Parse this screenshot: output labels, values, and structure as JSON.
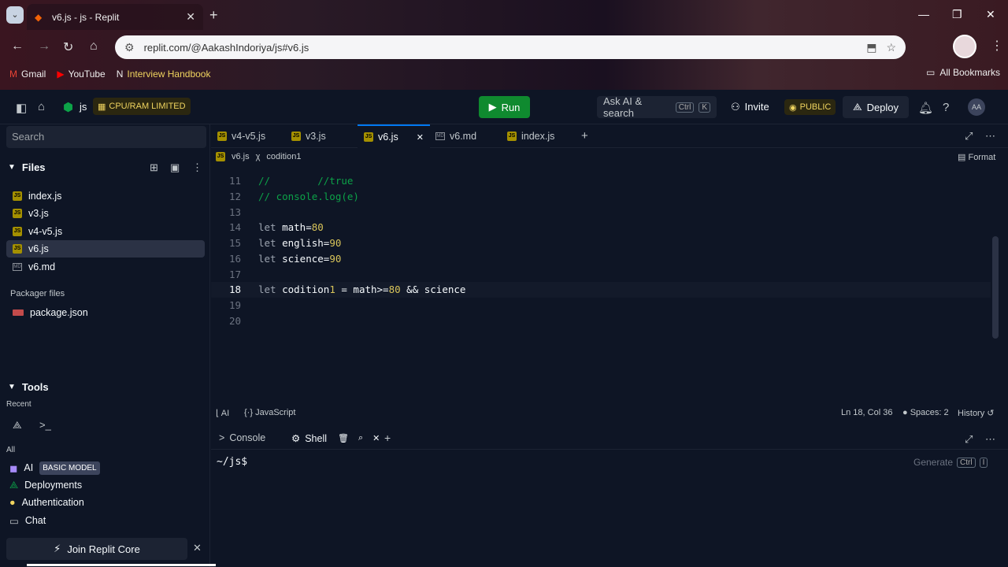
{
  "browser": {
    "tab_title": "v6.js - js - Replit",
    "url": "replit.com/@AakashIndoriya/js#v6.js",
    "bookmarks": [
      "Gmail",
      "YouTube",
      "Interview Handbook"
    ],
    "all_bookmarks": "All Bookmarks"
  },
  "topbar": {
    "repl_name": "js",
    "cpu_badge": "CPU/RAM LIMITED",
    "run_label": "Run",
    "ask_ai": "Ask AI & search",
    "kbd_ctrl": "Ctrl",
    "kbd_k": "K",
    "invite": "Invite",
    "public_badge": "PUBLIC",
    "deploy": "Deploy",
    "avatar": "AA"
  },
  "sidebar": {
    "search_placeholder": "Search",
    "files_header": "Files",
    "files": [
      {
        "name": "index.js",
        "type": "js"
      },
      {
        "name": "v3.js",
        "type": "js"
      },
      {
        "name": "v4-v5.js",
        "type": "js"
      },
      {
        "name": "v6.js",
        "type": "js",
        "selected": true
      },
      {
        "name": "v6.md",
        "type": "md"
      }
    ],
    "packager_header": "Packager files",
    "packager_files": [
      "package.json"
    ],
    "tools_header": "Tools",
    "recent_label": "Recent",
    "all_label": "All",
    "tools": [
      {
        "name": "AI",
        "badge": "BASIC MODEL"
      },
      {
        "name": "Deployments"
      },
      {
        "name": "Authentication"
      },
      {
        "name": "Chat"
      }
    ],
    "join": "Join Replit Core"
  },
  "editor": {
    "tabs": [
      "v4-v5.js",
      "v3.js",
      "v6.js",
      "v6.md",
      "index.js"
    ],
    "active_tab": "v6.js",
    "breadcrumb_file": "v6.js",
    "breadcrumb_symbol": "codition1",
    "format_label": "Format",
    "lines": [
      {
        "n": "11",
        "text": "//        //true"
      },
      {
        "n": "12",
        "text": "// console.log(e)"
      },
      {
        "n": "13",
        "text": ""
      },
      {
        "n": "14",
        "text": "let math=80"
      },
      {
        "n": "15",
        "text": "let english=90"
      },
      {
        "n": "16",
        "text": "let science=90"
      },
      {
        "n": "17",
        "text": ""
      },
      {
        "n": "18",
        "text": "let codition1 = math>=80 && science"
      },
      {
        "n": "19",
        "text": ""
      },
      {
        "n": "20",
        "text": ""
      }
    ],
    "status": {
      "ai": "AI",
      "language": "JavaScript",
      "position": "Ln 18, Col 36",
      "spaces": "Spaces: 2",
      "history": "History"
    }
  },
  "console": {
    "tab_console": "Console",
    "tab_shell": "Shell",
    "prompt": "~/js$",
    "generate": "Generate",
    "kbd_ctrl": "Ctrl",
    "kbd_i": "I"
  }
}
